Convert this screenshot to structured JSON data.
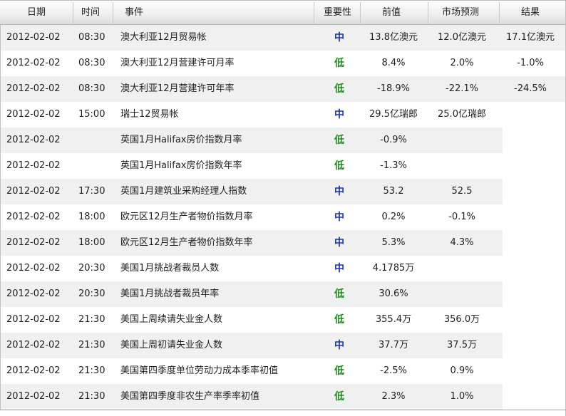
{
  "columns": {
    "date": "日期",
    "time": "时间",
    "event": "事件",
    "importance": "重要性",
    "previous": "前值",
    "forecast": "市场预测",
    "actual": "结果"
  },
  "rows": [
    {
      "date": "2012-02-02",
      "time": "08:30",
      "event": "澳大利亚12月贸易帐",
      "importance": "中",
      "level": "mid",
      "previous": "13.8亿澳元",
      "forecast": "12.0亿澳元",
      "actual": "17.1亿澳元"
    },
    {
      "date": "2012-02-02",
      "time": "08:30",
      "event": "澳大利亚12月营建许可月率",
      "importance": "低",
      "level": "low",
      "previous": "8.4%",
      "forecast": "2.0%",
      "actual": "-1.0%"
    },
    {
      "date": "2012-02-02",
      "time": "08:30",
      "event": "澳大利亚12月营建许可年率",
      "importance": "低",
      "level": "low",
      "previous": "-18.9%",
      "forecast": "-22.1%",
      "actual": "-24.5%"
    },
    {
      "date": "2012-02-02",
      "time": "15:00",
      "event": "瑞士12贸易帐",
      "importance": "中",
      "level": "mid",
      "previous": "29.5亿瑞郎",
      "forecast": "25.0亿瑞郎",
      "actual": ""
    },
    {
      "date": "2012-02-02",
      "time": "",
      "event": "英国1月Halifax房价指数月率",
      "importance": "低",
      "level": "low",
      "previous": "-0.9%",
      "forecast": "",
      "actual": ""
    },
    {
      "date": "2012-02-02",
      "time": "",
      "event": "英国1月Halifax房价指数年率",
      "importance": "低",
      "level": "low",
      "previous": "-1.3%",
      "forecast": "",
      "actual": ""
    },
    {
      "date": "2012-02-02",
      "time": "17:30",
      "event": "英国1月建筑业采购经理人指数",
      "importance": "中",
      "level": "mid",
      "previous": "53.2",
      "forecast": "52.5",
      "actual": ""
    },
    {
      "date": "2012-02-02",
      "time": "18:00",
      "event": "欧元区12月生产者物价指数月率",
      "importance": "中",
      "level": "mid",
      "previous": "0.2%",
      "forecast": "-0.1%",
      "actual": ""
    },
    {
      "date": "2012-02-02",
      "time": "18:00",
      "event": "欧元区12月生产者物价指数年率",
      "importance": "中",
      "level": "mid",
      "previous": "5.3%",
      "forecast": "4.3%",
      "actual": ""
    },
    {
      "date": "2012-02-02",
      "time": "20:30",
      "event": "美国1月挑战者裁员人数",
      "importance": "中",
      "level": "mid",
      "previous": "4.1785万",
      "forecast": "",
      "actual": ""
    },
    {
      "date": "2012-02-02",
      "time": "20:30",
      "event": "美国1月挑战者裁员年率",
      "importance": "低",
      "level": "low",
      "previous": "30.6%",
      "forecast": "",
      "actual": ""
    },
    {
      "date": "2012-02-02",
      "time": "21:30",
      "event": "美国上周续请失业金人数",
      "importance": "低",
      "level": "low",
      "previous": "355.4万",
      "forecast": "356.0万",
      "actual": ""
    },
    {
      "date": "2012-02-02",
      "time": "21:30",
      "event": "美国上周初请失业金人数",
      "importance": "中",
      "level": "mid",
      "previous": "37.7万",
      "forecast": "37.5万",
      "actual": ""
    },
    {
      "date": "2012-02-02",
      "time": "21:30",
      "event": "美国第四季度单位劳动力成本季率初值",
      "importance": "低",
      "level": "low",
      "previous": "-2.5%",
      "forecast": "0.9%",
      "actual": ""
    },
    {
      "date": "2012-02-02",
      "time": "21:30",
      "event": "美国第四季度非农生产率季率初值",
      "importance": "低",
      "level": "low",
      "previous": "2.3%",
      "forecast": "1.0%",
      "actual": ""
    }
  ],
  "colors": {
    "importance_mid": "#1a33b8",
    "importance_low": "#1f8a1f",
    "row_alt": "#f0f0f0"
  }
}
